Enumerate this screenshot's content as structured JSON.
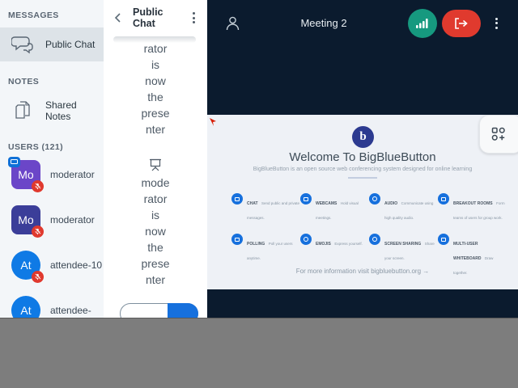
{
  "sidebar": {
    "messages_label": "MESSAGES",
    "public_chat_label": "Public Chat",
    "notes_label": "NOTES",
    "shared_notes_label": "Shared Notes",
    "users_label": "USERS (121)",
    "users": [
      {
        "initials": "Mo",
        "name": "moderator",
        "avatar_color": "#6b46c8",
        "shape": "square",
        "presenter": true,
        "muted": true
      },
      {
        "initials": "Mo",
        "name": "moderator",
        "avatar_color": "#3b3e99",
        "shape": "square",
        "presenter": false,
        "muted": true
      },
      {
        "initials": "At",
        "name": "attendee-10",
        "avatar_color": "#0f7ae5",
        "shape": "circle",
        "presenter": false,
        "muted": true
      },
      {
        "initials": "At",
        "name": "attendee-",
        "avatar_color": "#0f7ae5",
        "shape": "circle",
        "presenter": false,
        "muted": false
      }
    ]
  },
  "chat_panel": {
    "title": "Public Chat",
    "message1_full_text": "moderator is now the presenter (partially scrolled)",
    "message1_lines": [
      "rator",
      "is",
      "now",
      "the",
      "prese",
      "nter"
    ],
    "message2_full_text": "moderator is now the presenter",
    "message2_lines": [
      "mode",
      "rator",
      "is",
      "now",
      "the",
      "prese",
      "nter"
    ]
  },
  "top_bar": {
    "title": "Meeting 2"
  },
  "presentation": {
    "logo_letter": "b",
    "welcome_title": "Welcome To BigBlueButton",
    "welcome_subtitle": "BigBlueButton is an open source web conferencing system designed for online learning",
    "footer": "For more information visit bigbluebutton.org →",
    "features": [
      {
        "title": "CHAT",
        "desc": "Send public and private messages."
      },
      {
        "title": "WEBCAMS",
        "desc": "Hold visual meetings."
      },
      {
        "title": "AUDIO",
        "desc": "Communicate using high quality audio."
      },
      {
        "title": "BREAKOUT ROOMS",
        "desc": "Form teams of users for group work."
      },
      {
        "title": "POLLING",
        "desc": "Poll your users anytime."
      },
      {
        "title": "EMOJIS",
        "desc": "Express yourself."
      },
      {
        "title": "SCREEN SHARING",
        "desc": "Share your screen."
      },
      {
        "title": "MULTI-USER WHITEBOARD",
        "desc": "Draw together."
      }
    ]
  },
  "colors": {
    "main_background": "#0b1b2e",
    "sidebar_background": "#f3f6f9",
    "selected_item": "#dde3e8",
    "primary_blue": "#1670dd",
    "leave_red": "#e03a2e",
    "connection_teal": "#16997f",
    "muted_badge_red": "#e0392e",
    "slide_background": "#eef1f6",
    "logo_blue": "#2c3a90",
    "letterbox_gray": "#7d7d7d"
  }
}
